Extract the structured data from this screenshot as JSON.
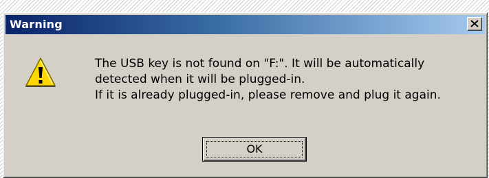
{
  "dialog": {
    "title": "Warning",
    "close_icon": "close-icon",
    "warning_icon": "warning-triangle-icon",
    "message_lines": [
      "The USB key is not found on \"F:\". It will be automatically",
      "detected when it will be plugged-in.",
      "If it is already plugged-in, please remove and plug it again."
    ],
    "ok_label": "OK"
  },
  "colors": {
    "dialog_face": "#d4d0c8",
    "title_gradient_start": "#0a246a",
    "title_gradient_end": "#a6caf0",
    "warning_yellow": "#ffd700"
  }
}
